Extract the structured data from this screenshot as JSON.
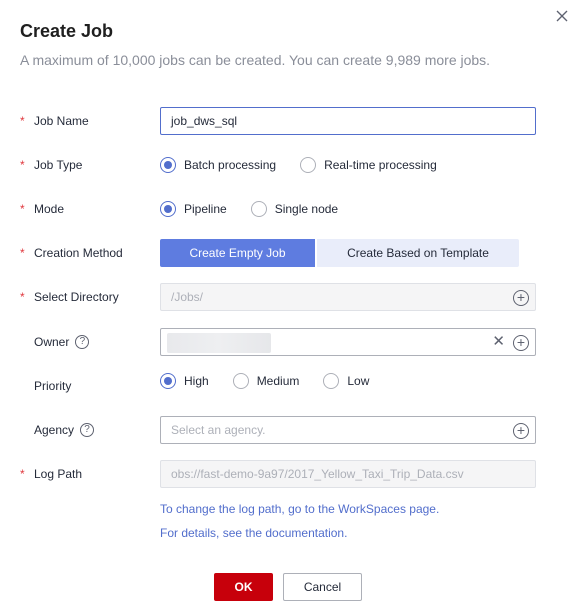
{
  "dialog": {
    "title": "Create Job",
    "subtitle": "A maximum of 10,000 jobs can be created. You can create 9,989 more jobs."
  },
  "icons": {
    "close": "close-icon",
    "help": "question-circle-icon",
    "add": "plus-circle-icon",
    "clear": "clear-x-icon"
  },
  "colors": {
    "accent": "#5e7ce0",
    "link": "#526ecc",
    "primary_button": "#c7000b",
    "required": "#e0383e"
  },
  "form": {
    "job_name": {
      "label": "Job Name",
      "value": "job_dws_sql"
    },
    "job_type": {
      "label": "Job Type",
      "options": [
        "Batch processing",
        "Real-time processing"
      ],
      "selected": "Batch processing"
    },
    "mode": {
      "label": "Mode",
      "options": [
        "Pipeline",
        "Single node"
      ],
      "selected": "Pipeline"
    },
    "creation_method": {
      "label": "Creation Method",
      "options": [
        "Create Empty Job",
        "Create Based on Template"
      ],
      "selected": "Create Empty Job"
    },
    "select_directory": {
      "label": "Select Directory",
      "value": "/Jobs/"
    },
    "owner": {
      "label": "Owner",
      "help": "?"
    },
    "priority": {
      "label": "Priority",
      "options": [
        "High",
        "Medium",
        "Low"
      ],
      "selected": "High"
    },
    "agency": {
      "label": "Agency",
      "help": "?",
      "placeholder": "Select an agency."
    },
    "log_path": {
      "label": "Log Path",
      "value": "obs://fast-demo-9a97/2017_Yellow_Taxi_Trip_Data.csv",
      "hint_link": "To change the log path, go to the WorkSpaces page.",
      "doc_link": "For details, see the documentation."
    }
  },
  "footer": {
    "ok_label": "OK",
    "cancel_label": "Cancel"
  }
}
